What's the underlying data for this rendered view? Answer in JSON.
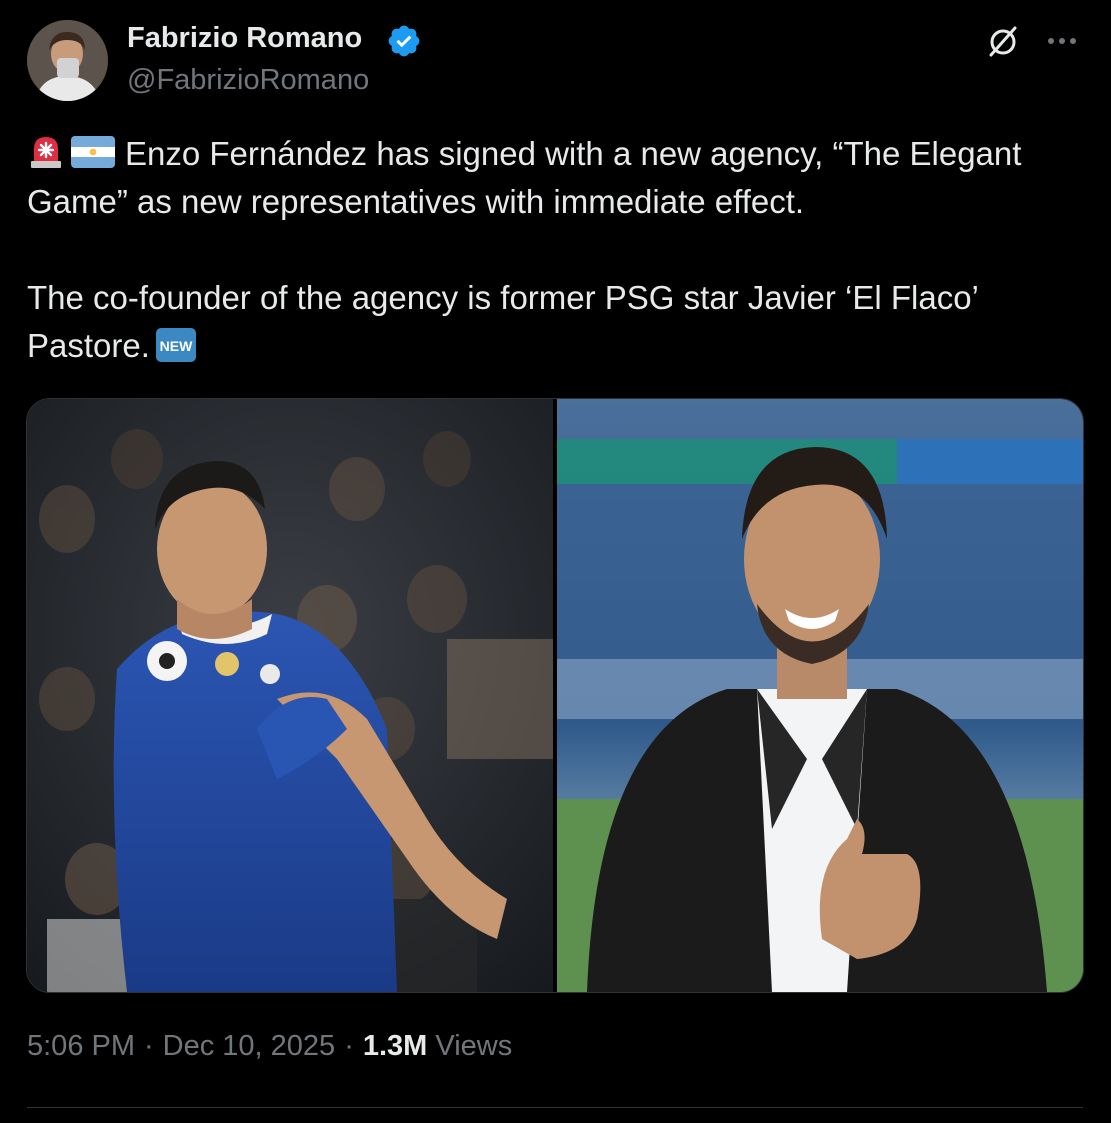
{
  "author": {
    "display_name": "Fabrizio Romano",
    "handle": "@FabrizioRomano",
    "verified": true,
    "verified_color": "#1d9bf0"
  },
  "tweet": {
    "line1_text": "Enzo Fernández has signed with a new agency, “The Elegant Game” as new representatives with immediate effect.",
    "line1_emojis": [
      "siren-icon",
      "argentina-flag-icon"
    ],
    "line2_text": "The co-founder of the agency is former PSG star Javier ‘El Flaco’ Pastore.",
    "line2_emoji": "new-button-icon",
    "new_emoji_label": "NEW"
  },
  "media": {
    "photos": [
      {
        "name": "enzo-fernandez-photo"
      },
      {
        "name": "javier-pastore-photo"
      }
    ]
  },
  "meta": {
    "time": "5:06 PM",
    "date": "Dec 10, 2025",
    "separator": "·",
    "views_count": "1.3M",
    "views_label": "Views"
  },
  "colors": {
    "background": "#000000",
    "text": "#e7e9ea",
    "muted": "#71767b",
    "border": "#2f3336"
  }
}
